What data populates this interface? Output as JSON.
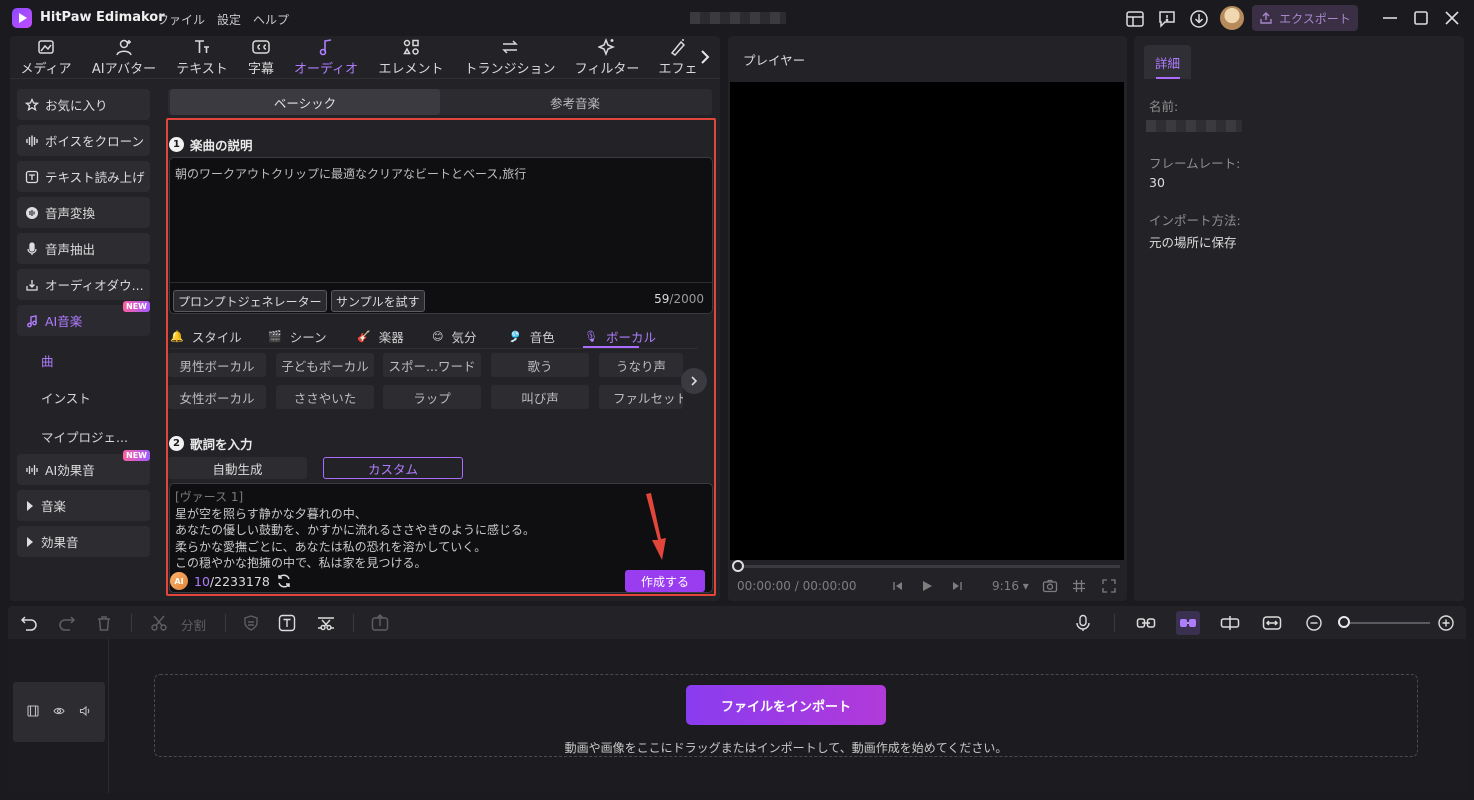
{
  "app": {
    "name": "HitPaw Edimakor",
    "menu": [
      "ファイル",
      "設定",
      "ヘルプ"
    ],
    "export_label": "エクスポート"
  },
  "tool_tabs": [
    {
      "label": "メディア",
      "icon": "media-icon"
    },
    {
      "label": "AIアバター",
      "icon": "avatar-icon"
    },
    {
      "label": "テキスト",
      "icon": "text-icon"
    },
    {
      "label": "字幕",
      "icon": "subtitle-icon"
    },
    {
      "label": "オーディオ",
      "icon": "audio-icon",
      "active": true
    },
    {
      "label": "エレメント",
      "icon": "element-icon"
    },
    {
      "label": "トランジション",
      "icon": "transition-icon"
    },
    {
      "label": "フィルター",
      "icon": "filter-icon"
    },
    {
      "label": "エフェ",
      "icon": "effect-icon"
    }
  ],
  "sidebar": {
    "items": [
      {
        "label": "お気に入り",
        "icon": "star-icon"
      },
      {
        "label": "ボイスをクローン",
        "icon": "voice-clone-icon"
      },
      {
        "label": "テキスト読み上げ",
        "icon": "tts-icon"
      },
      {
        "label": "音声変換",
        "icon": "voice-change-icon"
      },
      {
        "label": "音声抽出",
        "icon": "mic-icon"
      },
      {
        "label": "オーディオダウ...",
        "icon": "download-icon"
      },
      {
        "label": "AI音楽",
        "icon": "ai-music-icon",
        "badge": "NEW",
        "active": true
      },
      {
        "label": "AI効果音",
        "icon": "ai-sfx-icon",
        "badge": "NEW"
      },
      {
        "label": "音楽",
        "icon": "caret-right-icon"
      },
      {
        "label": "効果音",
        "icon": "caret-right-icon"
      }
    ],
    "sub_items": [
      "曲",
      "インスト",
      "マイプロジェ..."
    ]
  },
  "subtabs": [
    "ベーシック",
    "参考音楽"
  ],
  "section1": {
    "number": "1",
    "title": "楽曲の説明",
    "description": "朝のワークアウトクリップに最適なクリアなビートとベース,旅行",
    "prompt_generator": "プロンプトジェネレーター",
    "try_sample": "サンプルを試す",
    "count_current": "59",
    "count_max": "/2000"
  },
  "categories": [
    {
      "label": "スタイル",
      "icon": "bell-icon"
    },
    {
      "label": "シーン",
      "icon": "clapper-icon"
    },
    {
      "label": "楽器",
      "icon": "guitar-icon"
    },
    {
      "label": "気分",
      "icon": "smile-icon"
    },
    {
      "label": "音色",
      "icon": "tone-icon"
    },
    {
      "label": "ボーカル",
      "icon": "vocal-icon",
      "active": true
    }
  ],
  "chips_row1": [
    "男性ボーカル",
    "子どもボーカル",
    "スポー...ワード",
    "歌う",
    "うなり声"
  ],
  "chips_row2": [
    "女性ボーカル",
    "ささやいた",
    "ラップ",
    "叫び声",
    "ファルセット"
  ],
  "section2": {
    "number": "2",
    "title": "歌詞を入力",
    "auto_label": "自動生成",
    "custom_label": "カスタム",
    "lyrics": [
      "[ヴァース 1]",
      "星が空を照らす静かな夕暮れの中、",
      "あなたの優しい鼓動を、かすかに流れるささやきのように感じる。",
      "柔らかな愛撫ごとに、あなたは私の恐れを溶かしていく。",
      "この穏やかな抱擁の中で、私は家を見つける。"
    ]
  },
  "credits": {
    "coin_label": "AI",
    "used": "10",
    "total": "/2233178"
  },
  "create_label": "作成する",
  "player": {
    "title": "プレイヤー",
    "time_current": "00:00:00",
    "time_total": "/ 00:00:00",
    "ratio": "9:16"
  },
  "details": {
    "tab": "詳細",
    "name_label": "名前:",
    "framerate_label": "フレームレート:",
    "framerate_value": "30",
    "import_label": "インポート方法:",
    "import_value": "元の場所に保存"
  },
  "timeline": {
    "split_label": "分割",
    "import_button": "ファイルをインポート",
    "drop_hint": "動画や画像をここにドラッグまたはインポートして、動画作成を始めてください。"
  },
  "colors": {
    "accent": "#a96cff",
    "highlight_frame": "#e2453a",
    "create_button": "#9a3cf0"
  }
}
